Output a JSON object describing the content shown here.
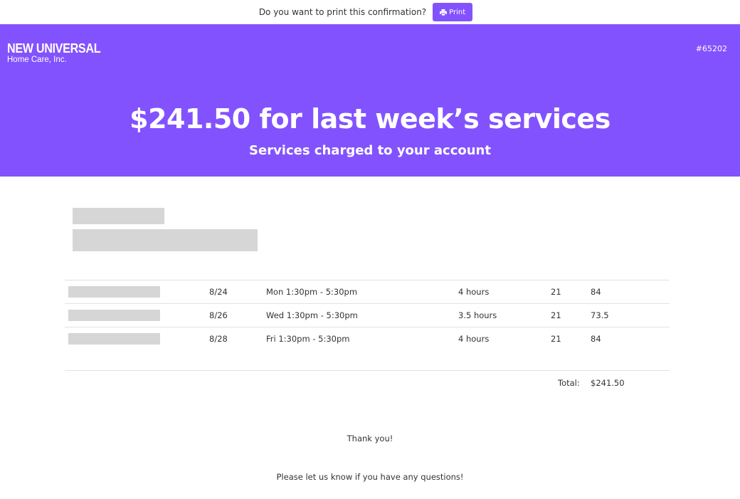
{
  "topbar": {
    "question": "Do you want to print this confirmation?",
    "print_label": "Print"
  },
  "header": {
    "logo_name": "NEW UNIVERSAL",
    "logo_subtitle": "Home Care, Inc.",
    "invoice_id": "#65202",
    "title": "$241.50 for last week’s services",
    "subtitle": "Services charged to your account"
  },
  "services": {
    "rows": [
      {
        "date": "8/24",
        "time": "Mon 1:30pm - 5:30pm",
        "hours": "4 hours",
        "rate": "21",
        "amount": "84"
      },
      {
        "date": "8/26",
        "time": "Wed 1:30pm - 5:30pm",
        "hours": "3.5 hours",
        "rate": "21",
        "amount": "73.5"
      },
      {
        "date": "8/28",
        "time": "Fri 1:30pm - 5:30pm",
        "hours": "4 hours",
        "rate": "21",
        "amount": "84"
      }
    ],
    "total_label": "Total:",
    "total_value": "$241.50"
  },
  "footer": {
    "thanks": "Thank you!",
    "questions": "Please let us know if you have any questions!"
  },
  "colors": {
    "brand": "#8352ff",
    "redaction": "#d6d6d6"
  }
}
